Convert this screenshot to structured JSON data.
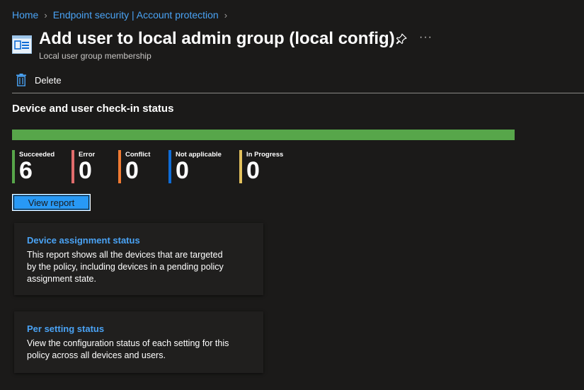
{
  "breadcrumb": {
    "items": [
      "Home",
      "Endpoint security | Account protection"
    ]
  },
  "header": {
    "title": "Add user to local admin group (local config)",
    "subtitle": "Local user group membership",
    "more_label": "···",
    "icon": "policy-document-icon"
  },
  "toolbar": {
    "delete_label": "Delete"
  },
  "checkin": {
    "title": "Device and user check-in status",
    "progress_succeeded_fraction": 1.0,
    "statuses": [
      {
        "label": "Succeeded",
        "count": "6",
        "color": "#57a64a"
      },
      {
        "label": "Error",
        "count": "0",
        "color": "#e06c6c"
      },
      {
        "label": "Conflict",
        "count": "0",
        "color": "#f07a32"
      },
      {
        "label": "Not applicable",
        "count": "0",
        "color": "#0f6cd6"
      },
      {
        "label": "In Progress",
        "count": "0",
        "color": "#e3c15d"
      }
    ],
    "view_report_label": "View report"
  },
  "cards": [
    {
      "title": "Device assignment status",
      "description": "This report shows all the devices that are targeted by the policy, including devices in a pending policy assignment state."
    },
    {
      "title": "Per setting status",
      "description": "View the configuration status of each setting for this policy across all devices and users."
    }
  ]
}
